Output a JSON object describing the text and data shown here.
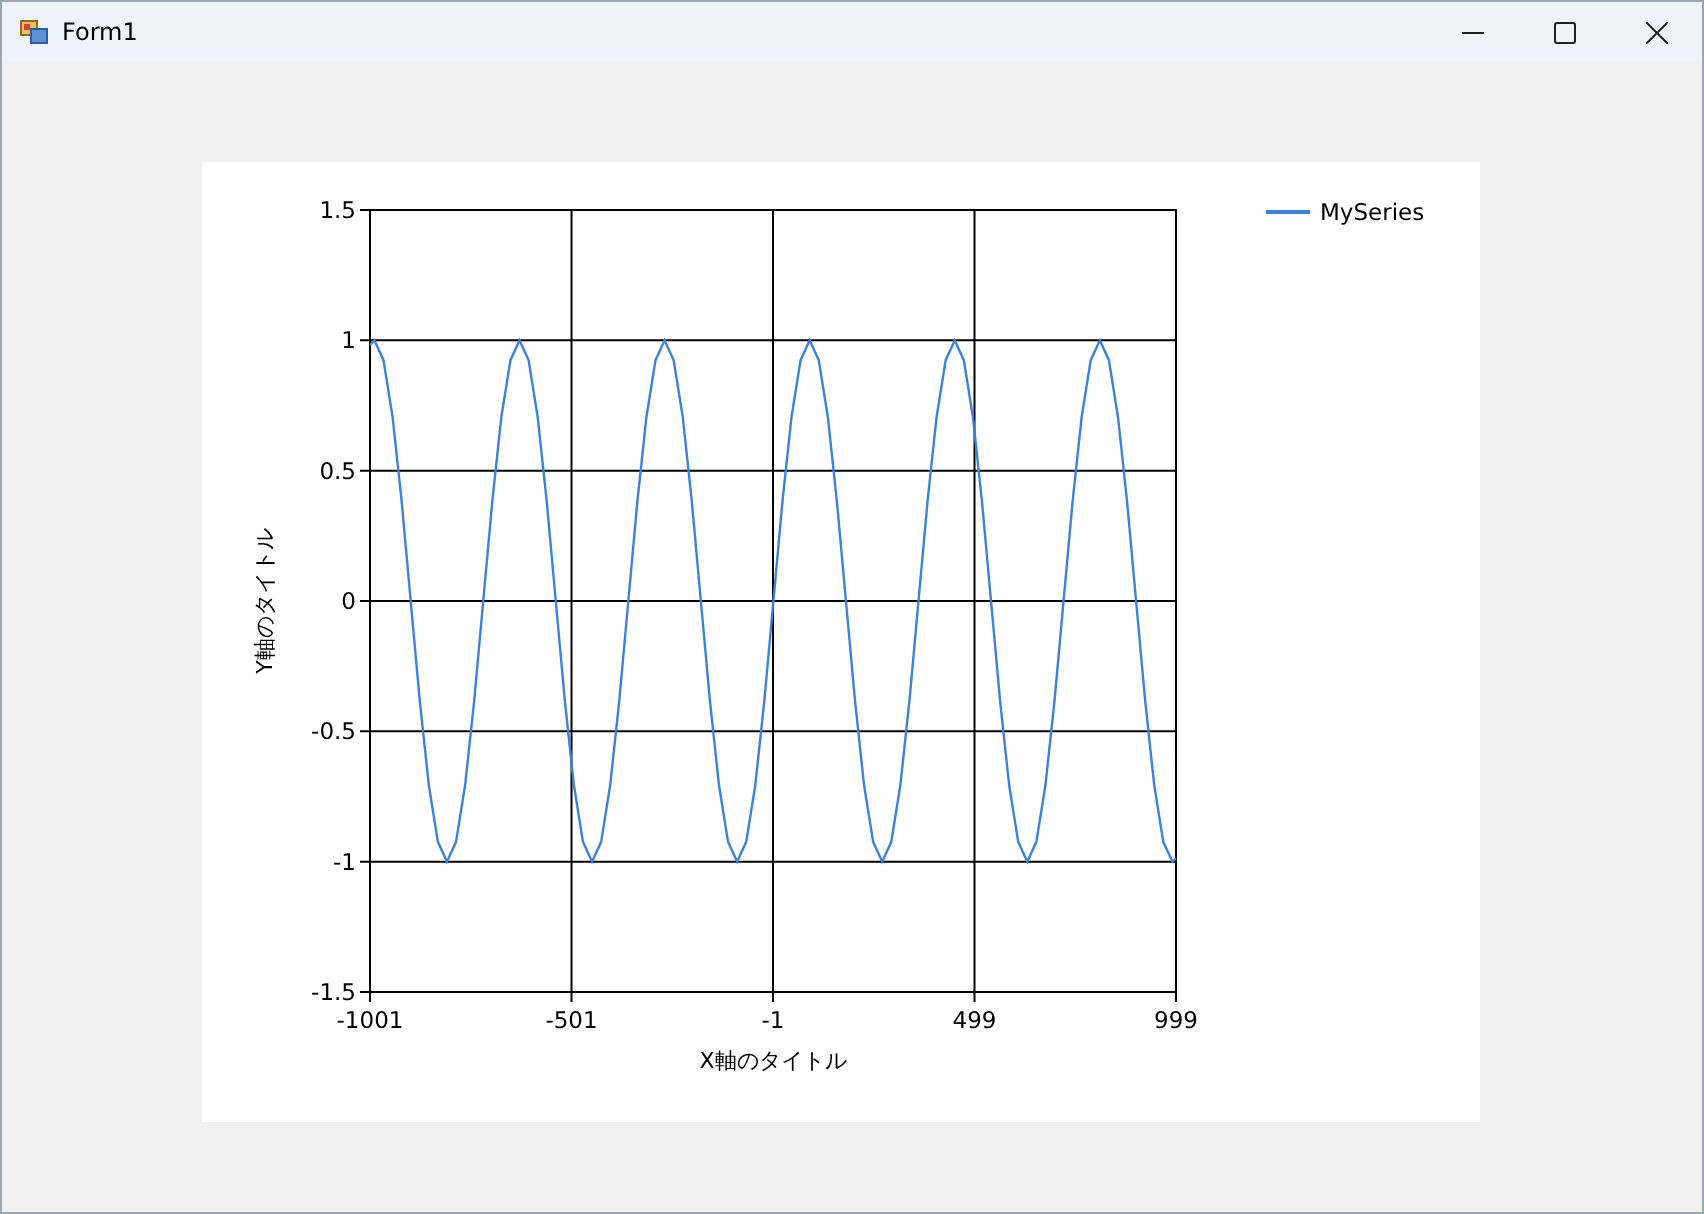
{
  "window": {
    "title": "Form1"
  },
  "chart": {
    "chart_data": {
      "type": "line",
      "xlabel": "X軸のタイトル",
      "ylabel": "Y軸のタイトル",
      "x": [
        -1001,
        -990,
        -967.5,
        -945,
        -922.5,
        -900,
        -877.5,
        -855,
        -832.5,
        -810,
        -787.5,
        -765,
        -742.5,
        -720,
        -697.5,
        -675,
        -652.5,
        -630,
        -607.5,
        -585,
        -562.5,
        -540,
        -517.5,
        -495,
        -472.5,
        -450,
        -427.5,
        -405,
        -382.5,
        -360,
        -337.5,
        -315,
        -292.5,
        -270,
        -247.5,
        -225,
        -202.5,
        -180,
        -157.5,
        -135,
        -112.5,
        -90,
        -67.5,
        -45,
        -22.5,
        0,
        22.5,
        45,
        67.5,
        90,
        112.5,
        135,
        157.5,
        180,
        202.5,
        225,
        247.5,
        270,
        292.5,
        315,
        337.5,
        360,
        382.5,
        405,
        427.5,
        450,
        472.5,
        495,
        517.5,
        540,
        562.5,
        585,
        607.5,
        630,
        652.5,
        675,
        697.5,
        720,
        742.5,
        765,
        787.5,
        810,
        832.5,
        855,
        877.5,
        900,
        922.5,
        945,
        967.5,
        990,
        999
      ],
      "series": [
        {
          "name": "MySeries",
          "color": "#3c82dc",
          "values": [
            0.982,
            1,
            0.924,
            0.707,
            0.383,
            0,
            -0.383,
            -0.707,
            -0.924,
            -1,
            -0.924,
            -0.707,
            -0.383,
            0,
            0.383,
            0.707,
            0.924,
            1,
            0.924,
            0.707,
            0.383,
            0,
            -0.383,
            -0.707,
            -0.924,
            -1,
            -0.924,
            -0.707,
            -0.383,
            0,
            0.383,
            0.707,
            0.924,
            1,
            0.924,
            0.707,
            0.383,
            0,
            -0.383,
            -0.707,
            -0.924,
            -1,
            -0.924,
            -0.707,
            -0.383,
            0,
            0.383,
            0.707,
            0.924,
            1,
            0.924,
            0.707,
            0.383,
            0,
            -0.383,
            -0.707,
            -0.924,
            -1,
            -0.924,
            -0.707,
            -0.383,
            0,
            0.383,
            0.707,
            0.924,
            1,
            0.924,
            0.707,
            0.383,
            0,
            -0.383,
            -0.707,
            -0.924,
            -1,
            -0.924,
            -0.707,
            -0.383,
            0,
            0.383,
            0.707,
            0.924,
            1,
            0.924,
            0.707,
            0.383,
            0,
            -0.383,
            -0.707,
            -0.924,
            -1,
            -0.988
          ]
        }
      ],
      "xlim": [
        -1001,
        999
      ],
      "ylim": [
        -1.5,
        1.5
      ],
      "xticks": [
        -1001,
        -501,
        -1,
        499,
        999
      ],
      "yticks": [
        -1.5,
        -1,
        -0.5,
        0,
        0.5,
        1,
        1.5
      ],
      "grid": true
    }
  }
}
